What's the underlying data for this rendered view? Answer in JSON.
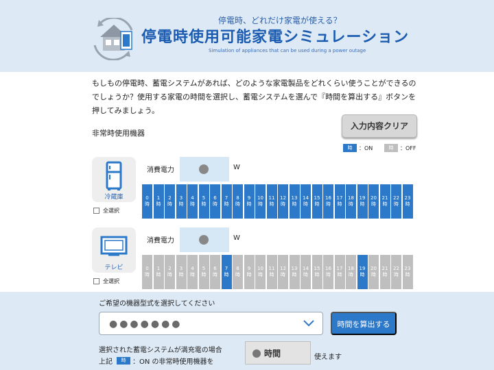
{
  "header": {
    "subtitle": "停電時、どれだけ家電が使える？",
    "title": "停電時使用可能家電シミュレーション",
    "title_en": "Simulation of appliances that can be used during a power outage"
  },
  "intro": "もしもの停電時、蓄電システムがあれば、どのような家電製品をどれくらい使うことができるのでしょうか？使用する家電の時間を選択し、蓄電システムを選んで『時間を算出する』ボタンを押してみましょう。",
  "section_label": "非常時使用機器",
  "clear_button": "入力内容クリア",
  "legend": {
    "chip_label": "時",
    "on_label": "：ON",
    "off_label": "：OFF",
    "on_color": "#2c79c9",
    "off_color": "#bfbfbf"
  },
  "appliances": [
    {
      "name": "冷蔵庫",
      "icon": "refrigerator-icon",
      "power_label": "消費電力",
      "power_value": "●",
      "power_unit": "W",
      "select_all": "全選択",
      "hours_on": [
        0,
        1,
        2,
        3,
        4,
        5,
        6,
        7,
        8,
        9,
        10,
        11,
        12,
        13,
        14,
        15,
        16,
        17,
        18,
        19,
        20,
        21,
        22,
        23
      ]
    },
    {
      "name": "テレビ",
      "icon": "tv-icon",
      "power_label": "消費電力",
      "power_value": "●",
      "power_unit": "W",
      "select_all": "全選択",
      "hours_on": [
        7,
        19
      ]
    }
  ],
  "hour_suffix": "時",
  "bottom": {
    "question": "ご希望の機器型式を選択してください",
    "model_value": "●●●●●●●",
    "calc_button": "時間を算出する",
    "result_line1": "選択された蓄電システムが満充電の場合",
    "result_prefix": "上記",
    "result_chip": "時",
    "result_middle": "：ON の非常時使用機器を",
    "result_value": "●",
    "result_unit": "時間",
    "result_suffix": "使えます"
  }
}
